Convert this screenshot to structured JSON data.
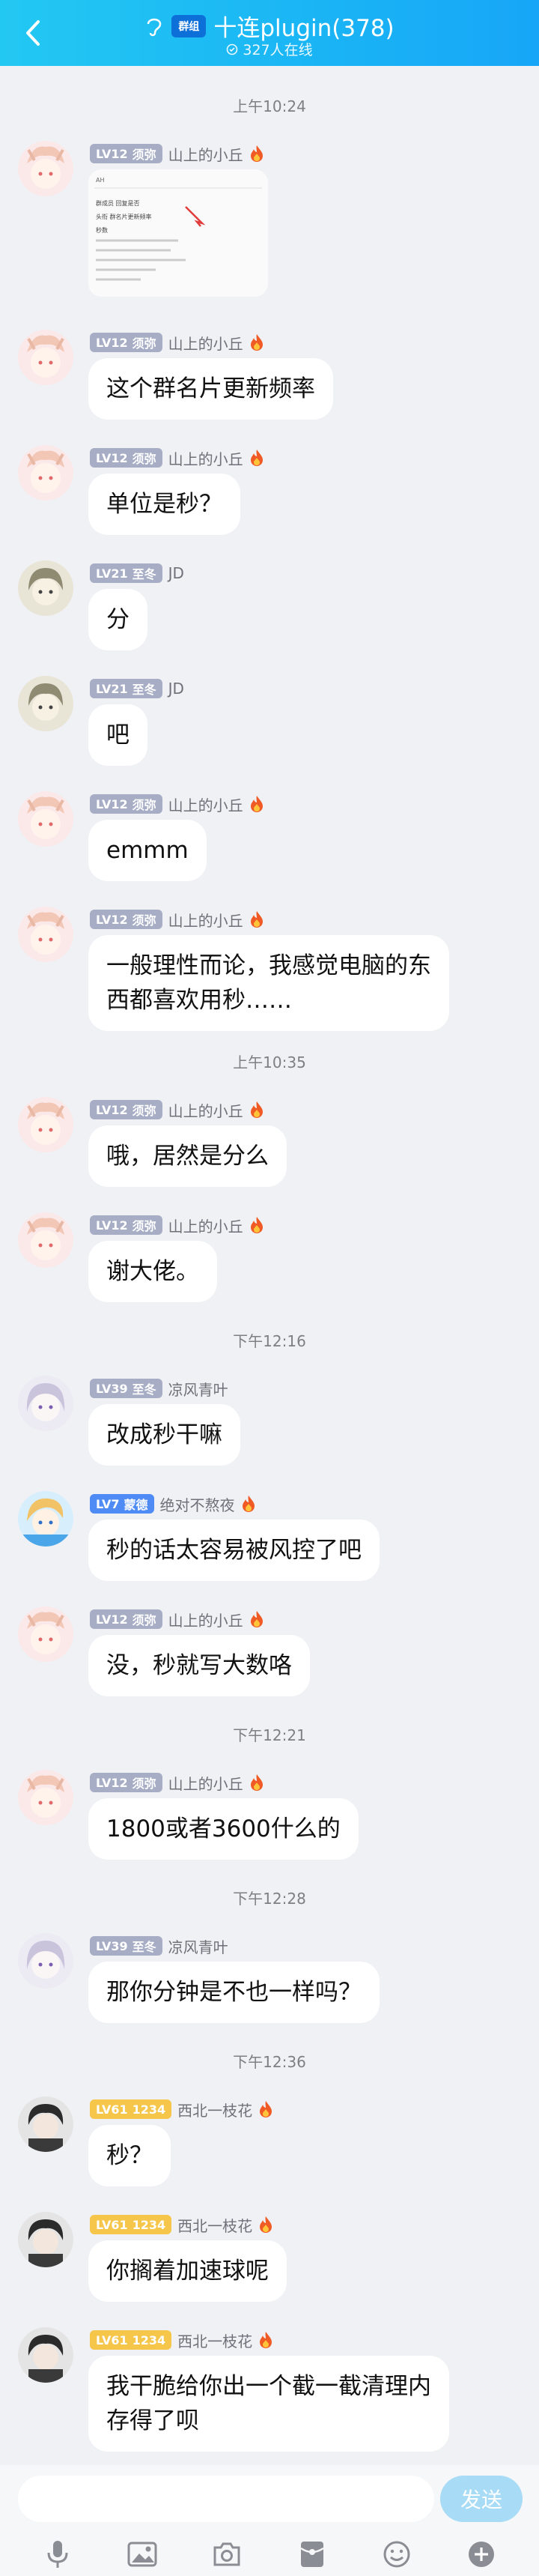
{
  "header": {
    "title": "十连plugin(378)",
    "online": "327人在线",
    "badge_text": "群组"
  },
  "times": [
    "上午10:24",
    "上午10:35",
    "下午12:16",
    "下午12:21",
    "下午12:28",
    "下午12:36"
  ],
  "users": {
    "shanshang": {
      "level": "LV12",
      "title": "须弥",
      "name": "山上的小丘",
      "flame": true,
      "badge": "gray"
    },
    "jd": {
      "level": "LV21",
      "title": "至冬",
      "name": "JD",
      "flame": false,
      "badge": "gray"
    },
    "liangfeng": {
      "level": "LV39",
      "title": "至冬",
      "name": "凉风青叶",
      "flame": false,
      "badge": "gray"
    },
    "juedui": {
      "level": "LV7",
      "title": "蒙德",
      "name": "绝对不熬夜",
      "flame": true,
      "badge": "blue"
    },
    "xibei": {
      "level": "LV61",
      "title": "1234",
      "name": "西北一枝花",
      "flame": true,
      "badge": "gold"
    }
  },
  "messages": [
    {
      "user": "shanshang",
      "type": "image",
      "image_lines": [
        "AH",
        "群成员 回复是否",
        "头衔 群名片更新频率",
        "秒数"
      ]
    },
    {
      "user": "shanshang",
      "text": "这个群名片更新频率"
    },
    {
      "user": "shanshang",
      "text": "单位是秒？"
    },
    {
      "user": "jd",
      "text": "分"
    },
    {
      "user": "jd",
      "text": "吧"
    },
    {
      "user": "shanshang",
      "text": "emmm"
    },
    {
      "user": "shanshang",
      "text_lines": [
        "一般理性而论，我感觉电脑的东",
        "西都喜欢用秒……"
      ]
    },
    {
      "user": "shanshang",
      "text": "哦，居然是分么"
    },
    {
      "user": "shanshang",
      "text": "谢大佬。"
    },
    {
      "user": "liangfeng",
      "text": "改成秒干嘛"
    },
    {
      "user": "juedui",
      "text": "秒的话太容易被风控了吧"
    },
    {
      "user": "shanshang",
      "text": "没，秒就写大数咯"
    },
    {
      "user": "shanshang",
      "text": "1800或者3600什么的"
    },
    {
      "user": "liangfeng",
      "text": "那你分钟是不也一样吗？"
    },
    {
      "user": "xibei",
      "text": "秒？"
    },
    {
      "user": "xibei",
      "text": "你搁着加速球呢"
    },
    {
      "user": "xibei",
      "text_lines": [
        "我干脆给你出一个截一截清理内",
        "存得了呗"
      ]
    }
  ],
  "input": {
    "placeholder": "",
    "send_label": "发送"
  },
  "toolbar": [
    "mic-icon",
    "image-icon",
    "camera-icon",
    "red-packet-icon",
    "emoji-icon",
    "plus-icon"
  ],
  "colors": {
    "header": "#1ab4f5",
    "send": "#a7dbf6",
    "bg": "#f0f1f5"
  }
}
